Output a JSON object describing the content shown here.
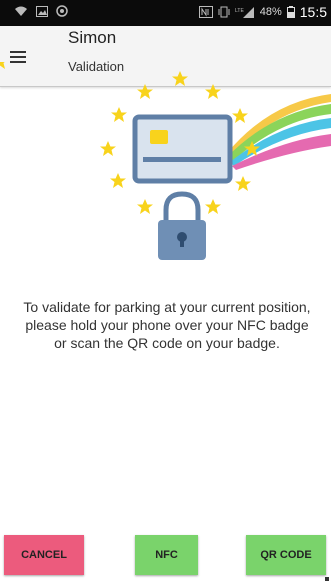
{
  "status_bar": {
    "battery": "48%",
    "time": "15:5"
  },
  "app_bar": {
    "title": "Simon",
    "subtitle": "Validation"
  },
  "message": "To validate for parking at your current position, please hold your phone over your NFC badge or scan the QR code on your badge.",
  "buttons": {
    "cancel": "CANCEL",
    "nfc": "NFC",
    "qr_code": "QR CODE"
  },
  "colors": {
    "cancel": "#ec5b7d",
    "confirm": "#7ad36b",
    "stars": "#f8d31c",
    "card": "#5f7fa6"
  },
  "icons": [
    "wifi-icon",
    "gallery-icon",
    "camera-icon",
    "nfc-icon",
    "vibrate-icon",
    "signal-icon",
    "battery-icon",
    "menu-icon",
    "eu-stars-icon",
    "card-icon",
    "padlock-icon"
  ]
}
